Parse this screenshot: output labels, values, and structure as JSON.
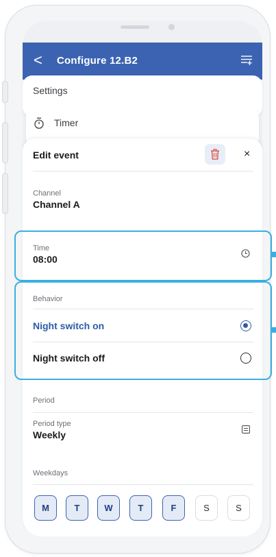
{
  "appbar": {
    "back_glyph": "<",
    "title": "Configure 12.B2",
    "menu_icon": "filter-list-icon"
  },
  "settings_label": "Settings",
  "timer_label": "Timer",
  "edit_event": {
    "title": "Edit event",
    "delete_icon": "trash-icon",
    "close_glyph": "×"
  },
  "channel": {
    "label": "Channel",
    "value": "Channel A"
  },
  "time": {
    "label": "Time",
    "value": "08:00"
  },
  "behavior": {
    "header": "Behavior",
    "options": [
      {
        "label": "Night switch on",
        "selected": true
      },
      {
        "label": "Night switch off",
        "selected": false
      }
    ]
  },
  "period": {
    "header": "Period",
    "type_label": "Period type",
    "type_value": "Weekly"
  },
  "weekdays": {
    "header": "Weekdays",
    "days": [
      {
        "label": "M",
        "selected": true
      },
      {
        "label": "T",
        "selected": true
      },
      {
        "label": "W",
        "selected": true
      },
      {
        "label": "T",
        "selected": true
      },
      {
        "label": "F",
        "selected": true
      },
      {
        "label": "S",
        "selected": false
      },
      {
        "label": "S",
        "selected": false
      }
    ]
  },
  "colors": {
    "primary": "#3b63b2",
    "highlight": "#3aaee0",
    "delete": "#d9483b"
  }
}
